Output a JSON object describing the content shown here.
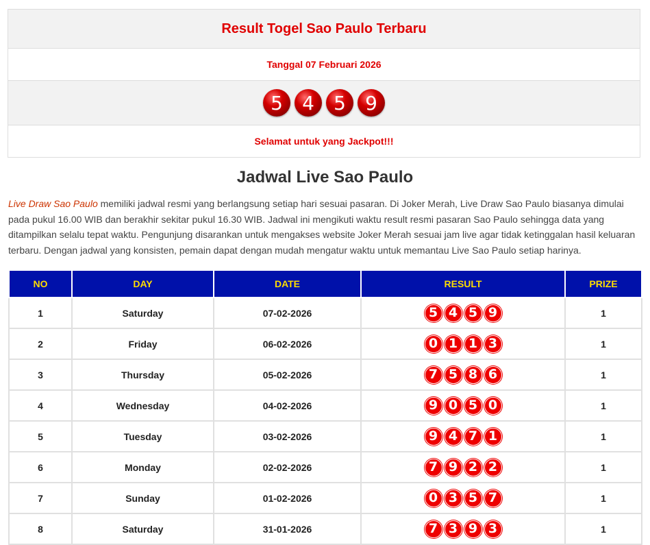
{
  "result_box": {
    "title": "Result Togel Sao Paulo Terbaru",
    "date": "Tanggal 07 Februari 2026",
    "numbers": [
      "5",
      "4",
      "5",
      "9"
    ],
    "message": "Selamat untuk yang Jackpot!!!"
  },
  "schedule": {
    "heading": "Jadwal Live Sao Paulo",
    "link_text": "Live Draw Sao Paulo",
    "paragraph": " memiliki jadwal resmi yang berlangsung setiap hari sesuai pasaran. Di Joker Merah, Live Draw Sao Paulo biasanya dimulai pada pukul 16.00 WIB dan berakhir sekitar pukul 16.30 WIB. Jadwal ini mengikuti waktu result resmi pasaran Sao Paulo sehingga data yang ditampilkan selalu tepat waktu. Pengunjung disarankan untuk mengakses website Joker Merah sesuai jam live agar tidak ketinggalan hasil keluaran terbaru. Dengan jadwal yang konsisten, pemain dapat dengan mudah mengatur waktu untuk memantau Live Sao Paulo setiap harinya."
  },
  "table": {
    "headers": [
      "NO",
      "DAY",
      "DATE",
      "RESULT",
      "PRIZE"
    ],
    "rows": [
      {
        "no": "1",
        "day": "Saturday",
        "date": "07-02-2026",
        "result": [
          "5",
          "4",
          "5",
          "9"
        ],
        "prize": "1"
      },
      {
        "no": "2",
        "day": "Friday",
        "date": "06-02-2026",
        "result": [
          "0",
          "1",
          "1",
          "3"
        ],
        "prize": "1"
      },
      {
        "no": "3",
        "day": "Thursday",
        "date": "05-02-2026",
        "result": [
          "7",
          "5",
          "8",
          "6"
        ],
        "prize": "1"
      },
      {
        "no": "4",
        "day": "Wednesday",
        "date": "04-02-2026",
        "result": [
          "9",
          "0",
          "5",
          "0"
        ],
        "prize": "1"
      },
      {
        "no": "5",
        "day": "Tuesday",
        "date": "03-02-2026",
        "result": [
          "9",
          "4",
          "7",
          "1"
        ],
        "prize": "1"
      },
      {
        "no": "6",
        "day": "Monday",
        "date": "02-02-2026",
        "result": [
          "7",
          "9",
          "2",
          "2"
        ],
        "prize": "1"
      },
      {
        "no": "7",
        "day": "Sunday",
        "date": "01-02-2026",
        "result": [
          "0",
          "3",
          "5",
          "7"
        ],
        "prize": "1"
      },
      {
        "no": "8",
        "day": "Saturday",
        "date": "31-01-2026",
        "result": [
          "7",
          "3",
          "9",
          "3"
        ],
        "prize": "1"
      }
    ]
  },
  "colors": {
    "accent_red": "#e00000",
    "header_blue": "#0011aa",
    "header_text_yellow": "#ffdd00",
    "link_orange": "#cc3300"
  }
}
